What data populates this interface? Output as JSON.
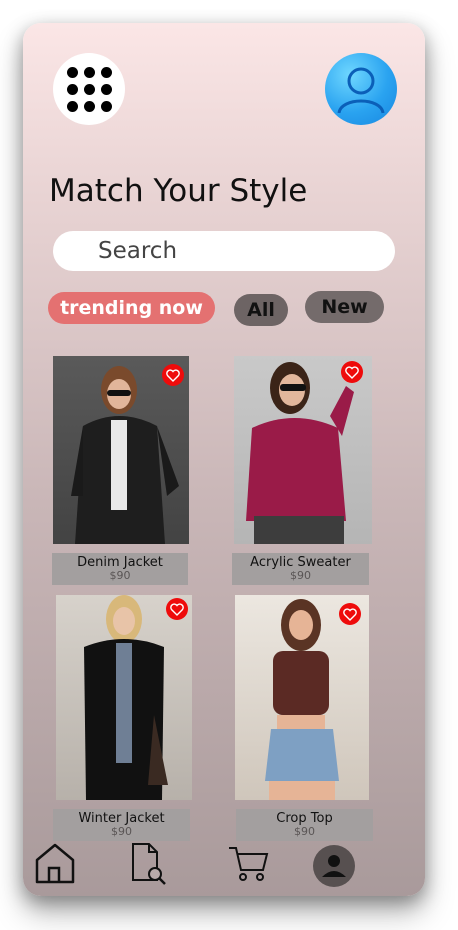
{
  "header": {
    "menu_icon": "grid-dots-icon",
    "profile_icon": "user-avatar-icon",
    "title": "Match Your Style"
  },
  "search": {
    "placeholder": "Search"
  },
  "filters": [
    {
      "label": "trending now",
      "active": true
    },
    {
      "label": "All",
      "active": false
    },
    {
      "label": "New",
      "active": false
    }
  ],
  "products": [
    {
      "name": "Denim Jacket",
      "price": "$90",
      "favorite_icon": "heart-icon"
    },
    {
      "name": "Acrylic Sweater",
      "price": "$90",
      "favorite_icon": "heart-icon"
    },
    {
      "name": "Winter Jacket",
      "price": "$90",
      "favorite_icon": "heart-icon"
    },
    {
      "name": "Crop Top",
      "price": "$90",
      "favorite_icon": "heart-icon"
    }
  ],
  "bottom_nav": [
    {
      "icon": "home-icon"
    },
    {
      "icon": "document-search-icon"
    },
    {
      "icon": "cart-icon"
    },
    {
      "icon": "profile-icon"
    }
  ],
  "colors": {
    "accent_chip": "#e47171",
    "heart": "#ee0b0b",
    "avatar_blue": "#2aa3f0"
  }
}
